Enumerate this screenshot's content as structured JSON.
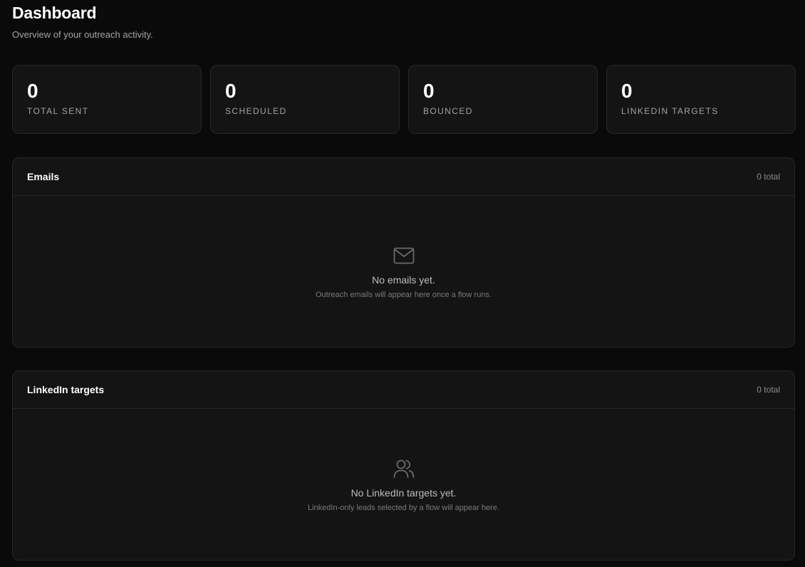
{
  "header": {
    "title": "Dashboard",
    "subtitle": "Overview of your outreach activity."
  },
  "stats": [
    {
      "value": "0",
      "label": "TOTAL SENT"
    },
    {
      "value": "0",
      "label": "SCHEDULED"
    },
    {
      "value": "0",
      "label": "BOUNCED"
    },
    {
      "value": "0",
      "label": "LINKEDIN TARGETS"
    }
  ],
  "emails": {
    "title": "Emails",
    "count": "0 total",
    "icon": "mail-icon",
    "empty_title": "No emails yet.",
    "empty_desc": "Outreach emails will appear here once a flow runs."
  },
  "linkedin": {
    "title": "LinkedIn targets",
    "count": "0 total",
    "icon": "users-icon",
    "empty_title": "No LinkedIn targets yet.",
    "empty_desc": "LinkedIn-only leads selected by a flow will appear here."
  },
  "colors": {
    "background": "#0a0a0a",
    "card": "#141414",
    "border": "#262626",
    "text_primary": "#ffffff",
    "text_muted": "#a3a3a3"
  }
}
